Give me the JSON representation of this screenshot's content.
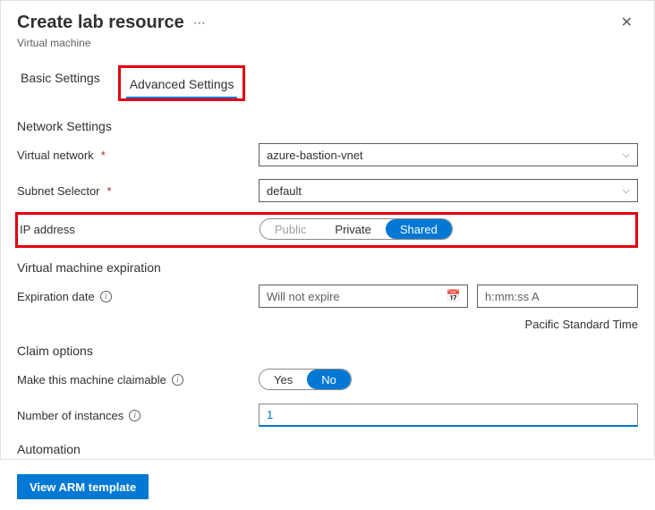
{
  "header": {
    "title": "Create lab resource",
    "subtitle": "Virtual machine"
  },
  "tabs": {
    "basic": "Basic Settings",
    "advanced": "Advanced Settings"
  },
  "network": {
    "section": "Network Settings",
    "vnet_label": "Virtual network",
    "vnet_value": "azure-bastion-vnet",
    "subnet_label": "Subnet Selector",
    "subnet_value": "default",
    "ip_label": "IP address",
    "ip_options": {
      "public": "Public",
      "private": "Private",
      "shared": "Shared"
    }
  },
  "expiration": {
    "section": "Virtual machine expiration",
    "date_label": "Expiration date",
    "date_placeholder": "Will not expire",
    "time_placeholder": "h:mm:ss A",
    "timezone": "Pacific Standard Time"
  },
  "claim": {
    "section": "Claim options",
    "claimable_label": "Make this machine claimable",
    "yes": "Yes",
    "no": "No",
    "instances_label": "Number of instances",
    "instances_value": "1"
  },
  "automation": {
    "section": "Automation",
    "view_arm": "View ARM template"
  }
}
